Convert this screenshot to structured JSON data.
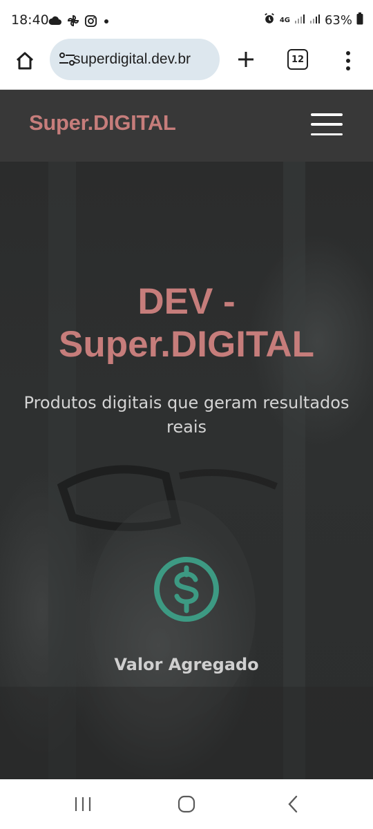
{
  "status_bar": {
    "time": "18:40",
    "network": "4G",
    "battery": "63%",
    "icons": [
      "cloud-icon",
      "pinwheel-icon",
      "instagram-icon",
      "dot-icon",
      "alarm-icon",
      "signal-icon",
      "signal-icon",
      "battery-icon"
    ]
  },
  "browser": {
    "url": "superdigital.dev.br",
    "tab_count": "12",
    "icons": [
      "home-icon",
      "tune-icon",
      "plus-icon",
      "tabs-icon",
      "more-vert-icon"
    ]
  },
  "site": {
    "logo": "Super.DIGITAL",
    "menu_icon": "hamburger-icon",
    "accent_color": "#c67d7b",
    "header_bg": "#383838"
  },
  "hero": {
    "title_line1": "DEV -",
    "title_line2": "Super.DIGITAL",
    "subtitle_line1": "Produtos digitais que geram resultados",
    "subtitle_line2": "reais",
    "feature_icon": "dollar-circle-icon",
    "feature_icon_color": "#3d9a83",
    "feature_label": "Valor Agregado"
  },
  "nav_bar": {
    "icons": [
      "recent-apps-icon",
      "home-icon",
      "back-icon"
    ]
  }
}
